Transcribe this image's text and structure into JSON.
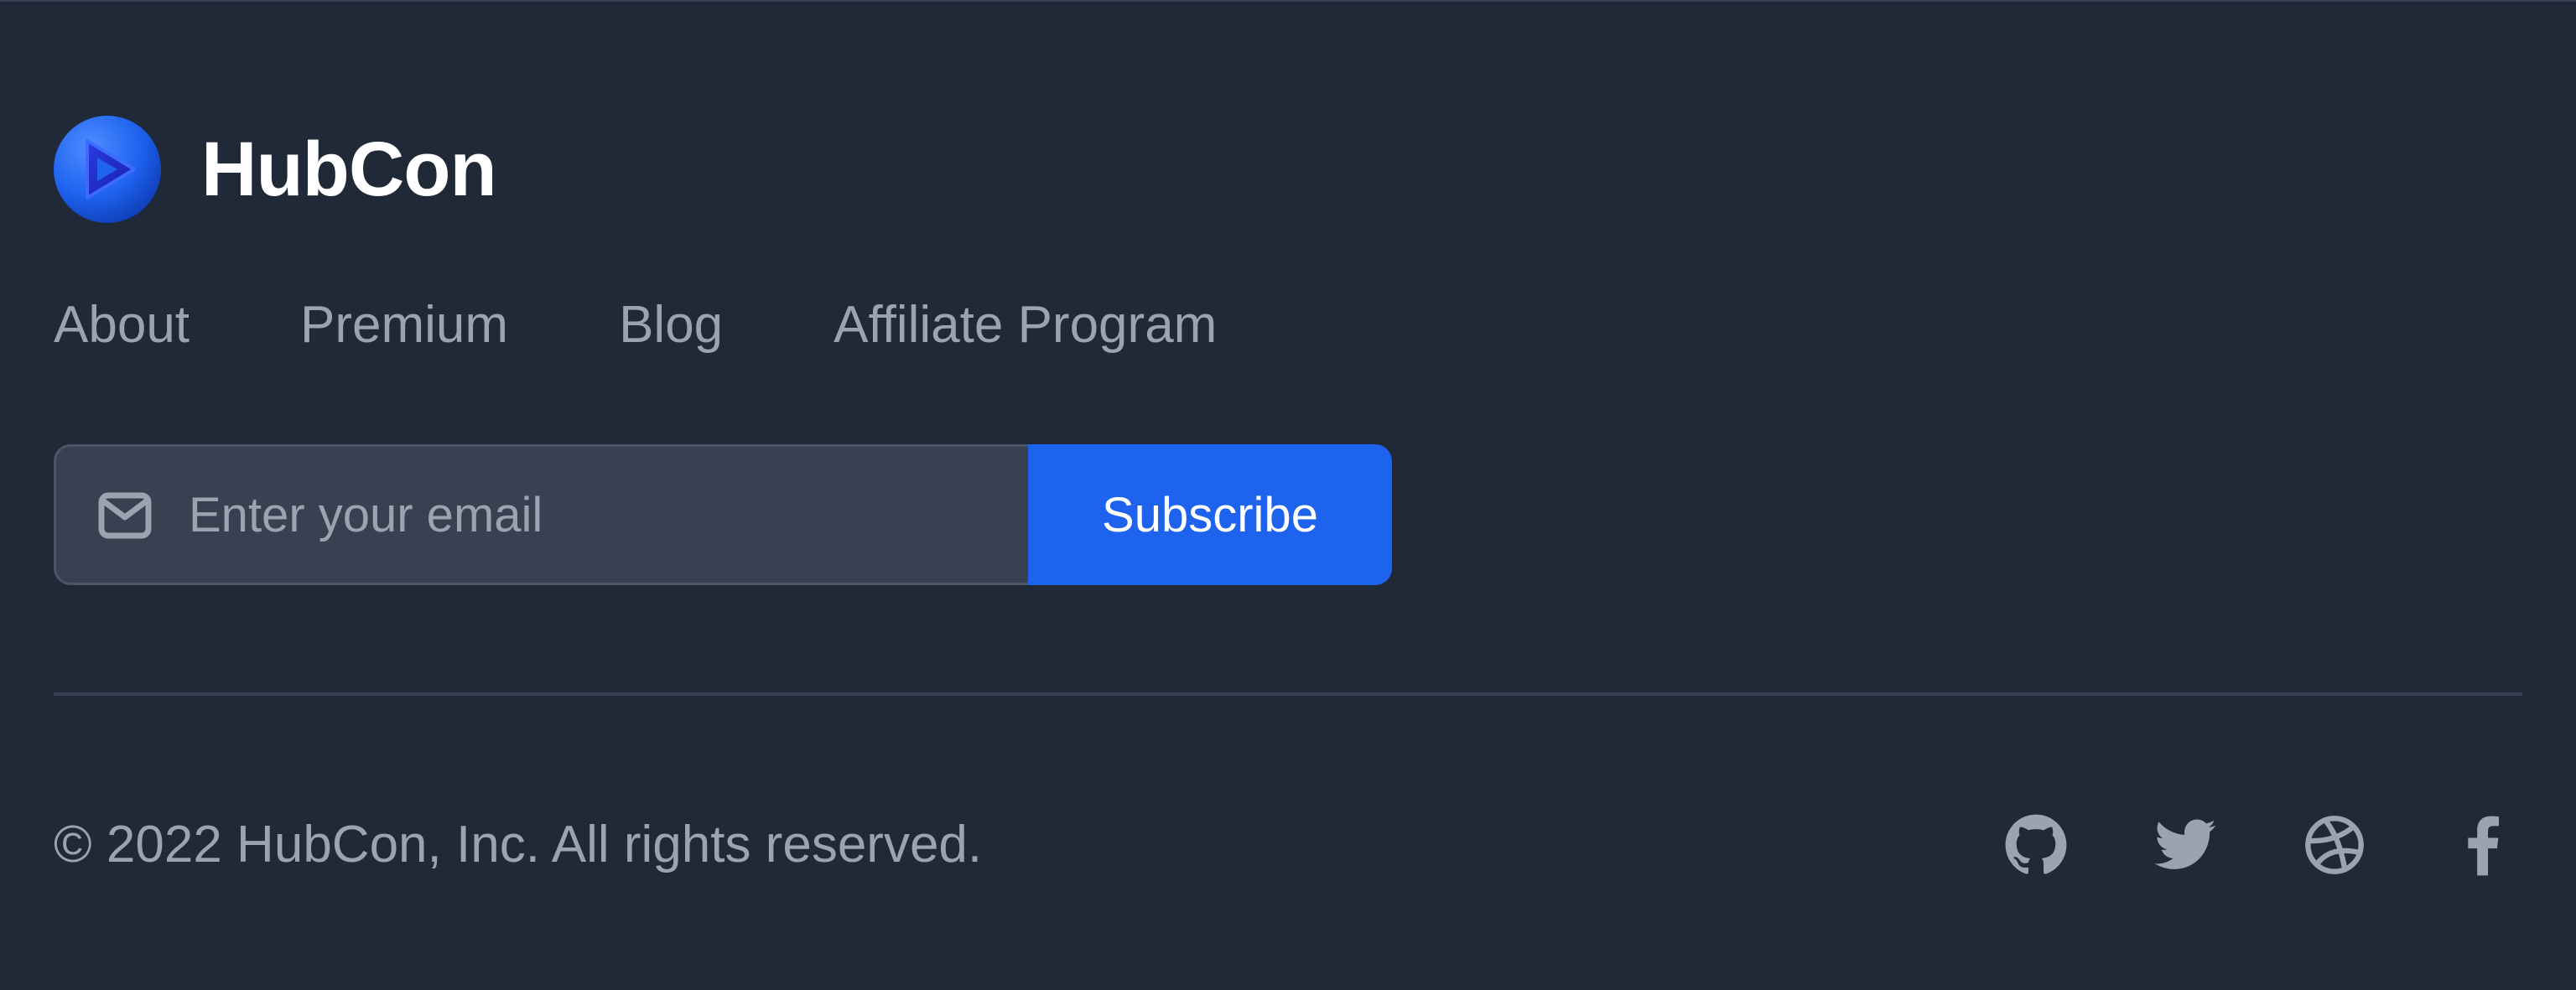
{
  "brand": {
    "name": "HubCon",
    "logo_icon": "hubcon-play-logo-icon"
  },
  "nav": {
    "items": [
      {
        "label": "About"
      },
      {
        "label": "Premium"
      },
      {
        "label": "Blog"
      },
      {
        "label": "Affiliate Program"
      }
    ]
  },
  "subscribe": {
    "email_icon": "envelope-icon",
    "email_placeholder": "Enter your email",
    "email_value": "",
    "button_label": "Subscribe"
  },
  "bottom": {
    "copyright": "© 2022 HubCon, Inc. All rights reserved.",
    "social_icons": [
      "github-icon",
      "twitter-icon",
      "dribbble-icon",
      "facebook-icon"
    ]
  },
  "colors": {
    "background": "#1f2937",
    "accent": "#1d63ed",
    "muted_text": "#9ca3af",
    "input_bg": "#374151"
  }
}
